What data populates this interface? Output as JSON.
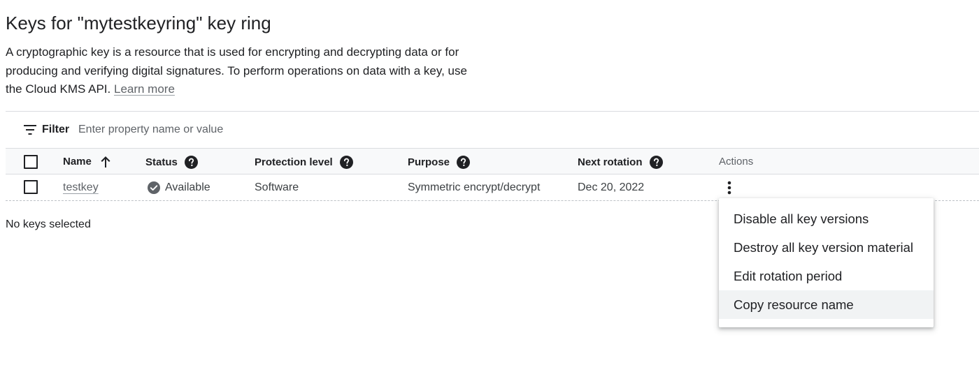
{
  "page": {
    "title": "Keys for \"mytestkeyring\" key ring",
    "description": "A cryptographic key is a resource that is used for encrypting and decrypting data or for producing and verifying digital signatures. To perform operations on data with a key, use the Cloud KMS API.",
    "learn_more": "Learn more"
  },
  "filter": {
    "label": "Filter",
    "placeholder": "Enter property name or value",
    "icon": "filter-icon"
  },
  "table": {
    "columns": {
      "name": "Name",
      "status": "Status",
      "protection_level": "Protection level",
      "purpose": "Purpose",
      "next_rotation": "Next rotation",
      "actions": "Actions"
    },
    "sort": {
      "column": "name",
      "direction": "ascending",
      "icon": "arrow-up-icon"
    },
    "rows": [
      {
        "name": "testkey",
        "status": "Available",
        "status_icon": "check-circle-icon",
        "protection_level": "Software",
        "purpose": "Symmetric encrypt/decrypt",
        "next_rotation": "Dec 20, 2022"
      }
    ]
  },
  "selection_status": "No keys selected",
  "actions_menu": {
    "items": [
      "Disable all key versions",
      "Destroy all key version material",
      "Edit rotation period",
      "Copy resource name"
    ],
    "highlighted_index": 3
  },
  "colors": {
    "text": "#202124",
    "secondary_text": "#5f6368",
    "divider": "#dadce0",
    "header_bg": "#f8f9fa",
    "menu_hover": "#f1f3f4"
  }
}
